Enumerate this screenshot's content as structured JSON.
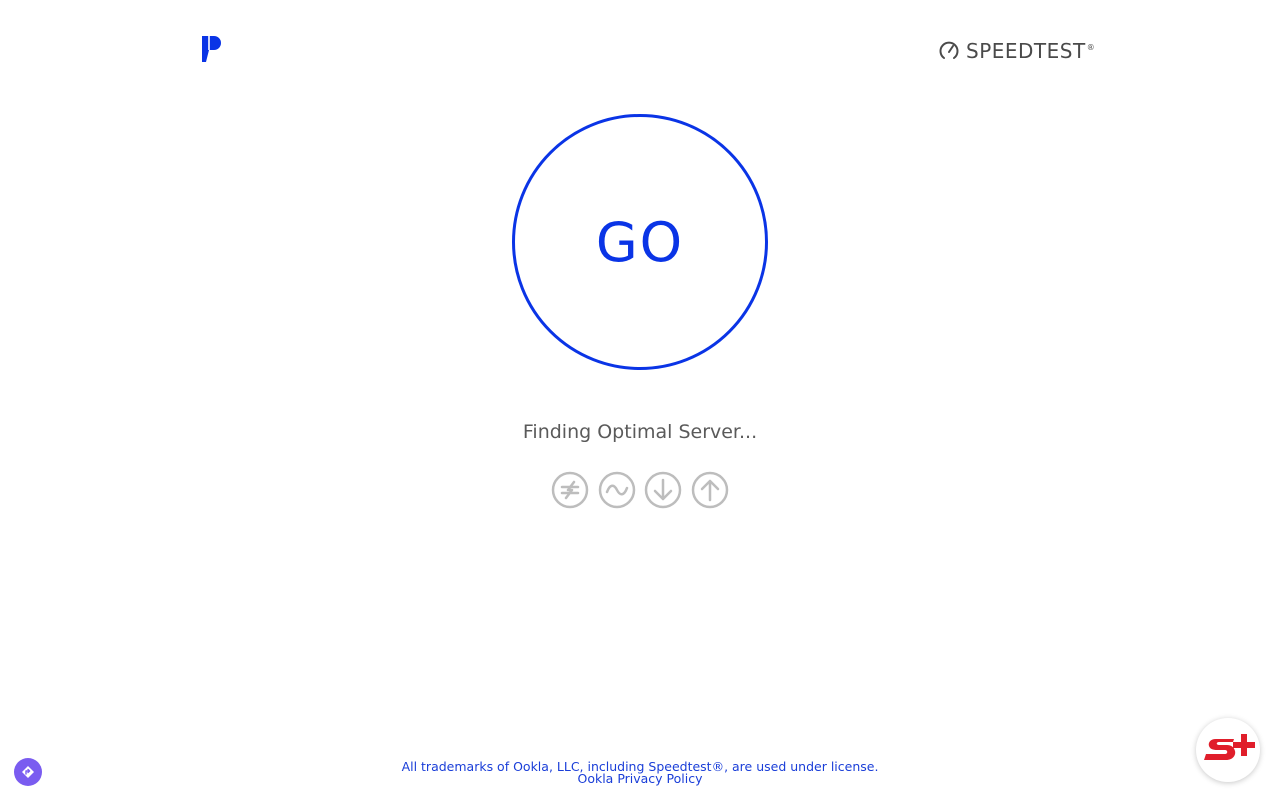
{
  "header": {
    "brand_logo": "p-brand-logo",
    "speedtest_logo_text": "SPEEDTEST",
    "speedtest_trademark": "®"
  },
  "main": {
    "go_label": "GO",
    "status_text": "Finding Optimal Server...",
    "stage_icons": [
      "ping-icon",
      "jitter-icon",
      "download-icon",
      "upload-icon"
    ]
  },
  "footer": {
    "trademark_notice": "All trademarks of Ookla, LLC, including Speedtest®, are used under license.",
    "privacy_link": "Ookla Privacy Policy"
  },
  "colors": {
    "accent": "#0a34e6",
    "text_gray": "#5a5a5a",
    "icon_gray": "#bdbdbd",
    "link": "#1a3ed8",
    "s_plus_red": "#e01e2b",
    "extension_purple": "#7a5cf0"
  },
  "widgets": {
    "extension_button_icon": "compass-icon",
    "s_plus_button_icon": "s-plus-logo-icon"
  }
}
